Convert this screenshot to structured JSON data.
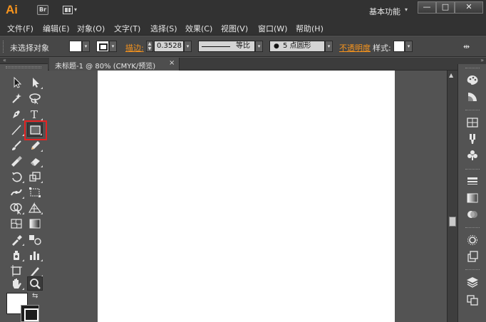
{
  "titlebar": {
    "app_logo": "Ai",
    "bridge_label": "Br",
    "workspace_label": "基本功能",
    "minimize": "—",
    "maximize": "□",
    "close": "✕"
  },
  "menu": [
    "文件(F)",
    "编辑(E)",
    "对象(O)",
    "文字(T)",
    "选择(S)",
    "效果(C)",
    "视图(V)",
    "窗口(W)",
    "帮助(H)"
  ],
  "controlbar": {
    "selection_status": "未选择对象",
    "stroke_label": "描边:",
    "stroke_weight": "0.3528",
    "stroke_profile": "等比",
    "brush": "5 点圆形",
    "opacity_label": "不透明度",
    "style_label": "样式:",
    "colors": {
      "link_orange": "#f7941d"
    }
  },
  "document": {
    "tab_title": "未标题-1 @ 80% (CMYK/预览)",
    "tab_close": "×"
  },
  "toolbar": {
    "collapse_glyph": "«",
    "tools": [
      "selection-tool",
      "direct-selection-tool",
      "magic-wand-tool",
      "lasso-tool",
      "pen-tool",
      "type-tool",
      "line-segment-tool",
      "rectangle-tool",
      "paintbrush-tool",
      "pencil-tool",
      "blob-brush-tool",
      "eraser-tool",
      "rotate-tool",
      "scale-tool",
      "width-tool",
      "free-transform-tool",
      "shape-builder-tool",
      "perspective-grid-tool",
      "mesh-tool",
      "gradient-tool",
      "eyedropper-tool",
      "blend-tool",
      "symbol-sprayer-tool",
      "column-graph-tool",
      "artboard-tool",
      "slice-tool",
      "hand-tool",
      "zoom-tool"
    ],
    "highlighted_tool": "rectangle-tool",
    "annotation_color": "#e52222"
  },
  "right_dock": {
    "collapse_glyph": "»",
    "panels": [
      "color-panel",
      "color-guide-panel",
      "swatches-panel",
      "brushes-panel",
      "symbols-panel",
      "stroke-panel",
      "gradient-panel",
      "transparency-panel",
      "appearance-panel",
      "graphic-styles-panel",
      "layers-panel",
      "artboards-panel"
    ]
  }
}
